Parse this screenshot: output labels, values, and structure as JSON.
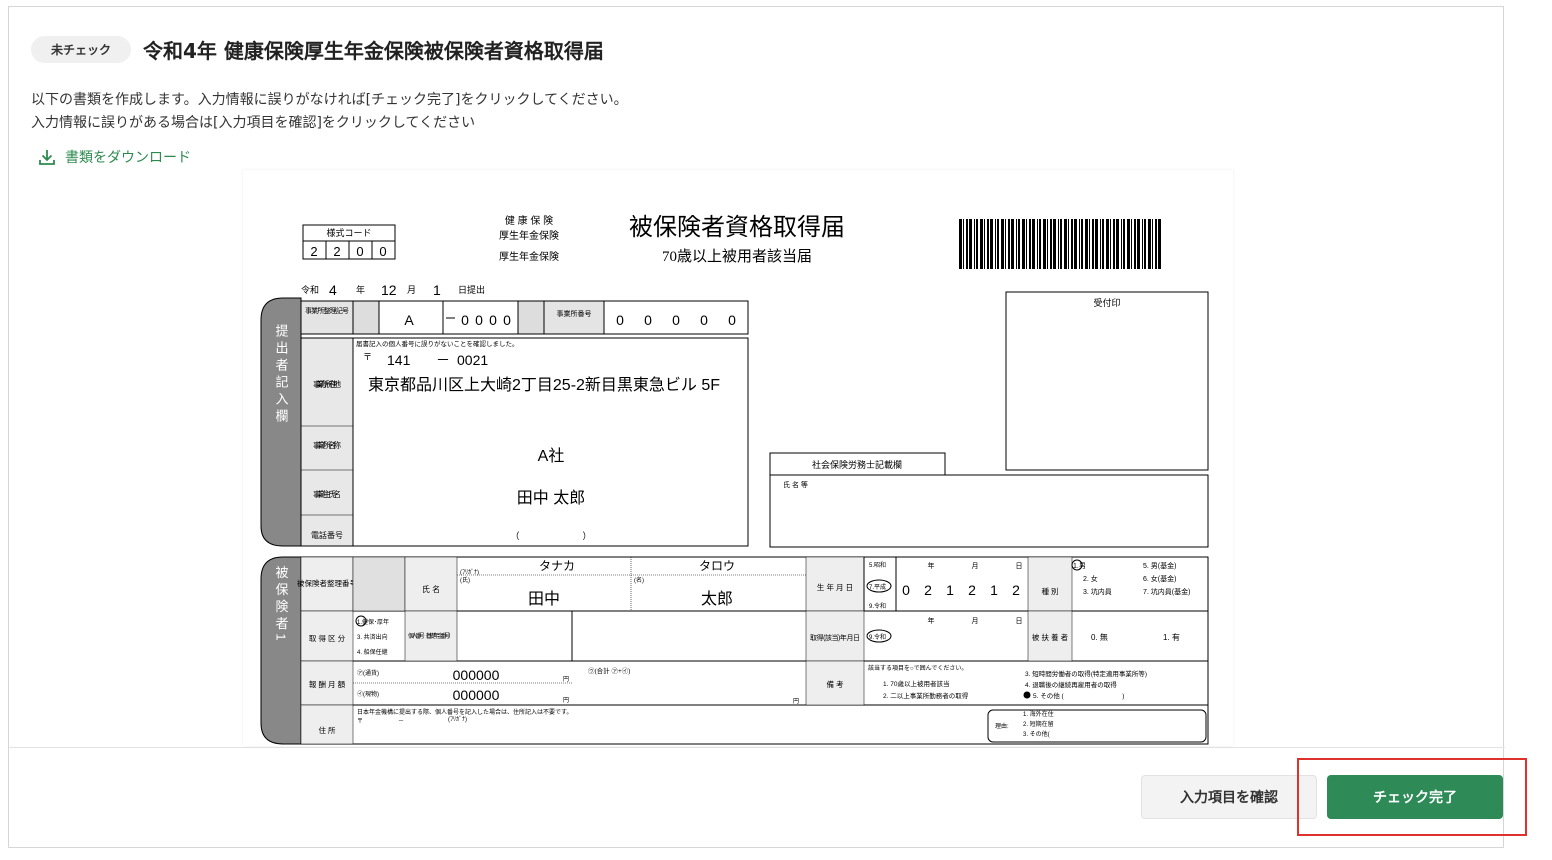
{
  "header": {
    "status_badge": "未チェック",
    "title": "令和4年 健康保険厚生年金保険被保険者資格取得届"
  },
  "description": {
    "line1": "以下の書類を作成します。入力情報に誤りがなければ[チェック完了]をクリックしてください。",
    "line2": "入力情報に誤りがある場合は[入力項目を確認]をクリックしてください"
  },
  "download": {
    "label": "書類をダウンロード",
    "icon": "download-icon"
  },
  "document": {
    "form_code_label": "様式コード",
    "form_code": [
      "2",
      "2",
      "0",
      "0"
    ],
    "insurance_types": [
      "健 康 保 険",
      "厚生年金保険",
      "厚生年金保険"
    ],
    "title": "被保険者資格取得届",
    "subtitle": "70歳以上被用者該当届",
    "date": {
      "era": "令和",
      "year": "4",
      "year_label": "年",
      "month": "12",
      "month_label": "月",
      "day": "1",
      "submit_label": "日提出"
    },
    "receipt_stamp_label": "受付印",
    "submitter_section_label": "提出者記入欄",
    "office_code_label": "事業所整理記号",
    "office_code": "A",
    "office_code_suffix": [
      "0",
      "0",
      "0",
      "0"
    ],
    "office_number_label": "事業所番号",
    "office_number": [
      "0",
      "0",
      "0",
      "0",
      "0"
    ],
    "my_number_note": "届書記入の個人番号に誤りがないことを確認しました。",
    "postal_mark": "〒",
    "postal_code_1": "141",
    "postal_dash": "－",
    "postal_code_2": "0021",
    "office_address_label": "事業所所在地",
    "office_address": "東京都品川区上大崎2丁目25-2新目黒東急ビル 5F",
    "office_name_label": "事業所名称",
    "office_name": "A社",
    "employer_name_label": "事業主氏名",
    "employer_name": "田中 太郎",
    "phone_label": "電話番号",
    "phone_parens": "（　　　　　　　）",
    "sharoushi_label": "社会保険労務士記載欄",
    "sharoushi_name_label": "氏 名 等",
    "insured_section_label": "被保険者1",
    "insured_number_label": "被保険者整理番号",
    "name_label": "氏 名",
    "furigana_label": "(ﾌﾘｶﾞﾅ)",
    "family_label": "(氏)",
    "given_label": "(名)",
    "kana_last": "タナカ",
    "kana_first": "タロウ",
    "last_name": "田中",
    "first_name": "太郎",
    "birth_label": "生 年 月 日",
    "birth_eras": [
      "5.昭和",
      "7.平成",
      "9.令和"
    ],
    "birth_date": [
      "0",
      "2",
      "1",
      "2",
      "1",
      "2"
    ],
    "ymd_labels": [
      "年",
      "月",
      "日"
    ],
    "gender_label": "種 別",
    "gender_options": [
      "1.男",
      "2. 女",
      "3. 坑内員",
      "5. 男(基金)",
      "6. 女(基金)",
      "7. 坑内員(基金)"
    ],
    "acq_type_label": "取 得 区 分",
    "acq_type_options": [
      "1.健保･厚年",
      "3. 共済出向",
      "4. 船保任継"
    ],
    "my_number_label": "個人番号〔基礎年金番号〕",
    "acq_date_label": "取得(該当)年月日",
    "acq_era": "9.令和",
    "dependent_label": "被 扶 養 者",
    "dependent_options": [
      "0. 無",
      "1. 有"
    ],
    "salary_label": "報 酬 月 額",
    "salary_currency_label": "㋐(通貨)",
    "salary_kind_label": "㋑(現物)",
    "salary_currency": "000000",
    "salary_kind": "000000",
    "yen": "円",
    "salary_total_label": "㋒(合計 ㋐+㋑)",
    "remarks_label": "備 考",
    "remarks_note": "該当する項目を○で囲んでください。",
    "remarks_options": [
      "1. 70歳以上被用者該当",
      "2. 二以上事業所勤務者の取得",
      "3. 短時間労働者の取得(特定適用事業所等)",
      "4. 退職後の継続再雇用者の取得",
      "5. その他 (　　　　　　　　　)"
    ],
    "address_label": "住 所",
    "address_note": "日本年金機構に提出する際、個人番号を記入した場合は、住所記入は不要です。",
    "address_furigana": "(ﾌﾘｶﾞﾅ)",
    "address_reason_label": "理由:",
    "address_reasons": [
      "1. 海外在住",
      "2. 短期在留",
      "3. その他("
    ]
  },
  "footer": {
    "confirm_button": "入力項目を確認",
    "done_button": "チェック完了"
  },
  "colors": {
    "accent": "#2e8b57",
    "highlight": "#e0322d"
  }
}
